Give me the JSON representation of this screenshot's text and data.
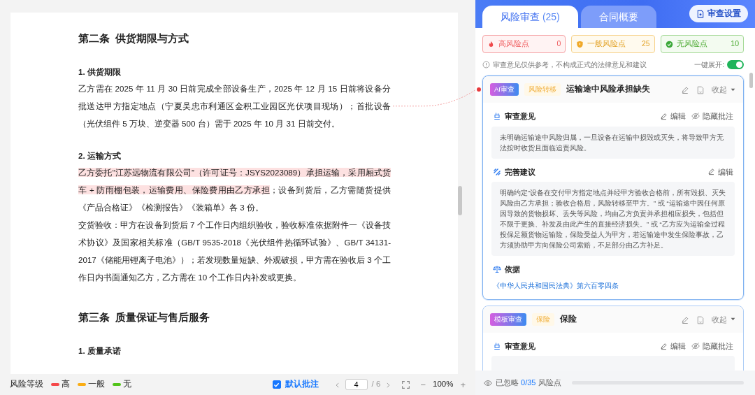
{
  "document": {
    "blocks": [
      {
        "kind": "heading",
        "text": "第二条  供货期限与方式"
      },
      {
        "kind": "subheading",
        "text": "**1.** 供货期限"
      },
      {
        "kind": "paragraph",
        "parts": [
          {
            "text": "乙方需在 2025 年 11 月 30 日前完成全部设备生产，2025 年 12 月 15 日前将设备分批送达甲方指定地点（宁夏吴忠市利通区金积工业园区光伏项目现场）；首批设备（光伏组件 5 万块、逆变器 500 台）需于 2025 年 10 月 31 日前交付。",
            "highlight": false
          }
        ]
      },
      {
        "kind": "subheading",
        "text": "**2.** 运输方式"
      },
      {
        "kind": "paragraph",
        "parts": [
          {
            "text": "乙方委托“江苏远物流有限公司”（许可证号：JSYS2023089）承担运输，采用厢式货车 + 防雨棚包装，运输费用、保险费用由乙方承担",
            "highlight": true
          },
          {
            "text": "；设备到货后，乙方需随货提供《产品合格证》《检测报告》《装箱单》各 3 份。",
            "highlight": false
          }
        ]
      },
      {
        "kind": "paragraph",
        "parts": [
          {
            "text": "交货验收：甲方在设备到货后 7 个工作日内组织验收，验收标准依据附件一《设备技术协议》及国家相关标准（GB/T 9535-2018《光伏组件热循环试验》、GB/T 34131-2017《储能用锂离子电池》）；若发现数量短缺、外观破损，甲方需在验收后 3 个工作日内书面通知乙方，乙方需在 10 个工作日内补发或更换。",
            "highlight": false
          }
        ]
      },
      {
        "kind": "heading",
        "text": "第三条  质量保证与售后服务"
      },
      {
        "kind": "subheading",
        "text": "**1.** 质量承诺"
      }
    ]
  },
  "bottom_bar": {
    "legend_title": "风险等级",
    "legend": [
      {
        "label": "高",
        "color": "#f5484a"
      },
      {
        "label": "一般",
        "color": "#faad14"
      },
      {
        "label": "无",
        "color": "#52c41a"
      }
    ],
    "default_annotation": {
      "label": "默认批注",
      "checked": true
    },
    "page": {
      "current": "4",
      "total": "/ 6"
    },
    "zoom": "100%",
    "zoom_out": "−",
    "zoom_in": "+"
  },
  "review_panel": {
    "tabs": [
      {
        "label": "风险审查",
        "count": "(25)",
        "selected": true
      },
      {
        "label": "合同概要",
        "selected": false
      }
    ],
    "settings_button": "审查设置",
    "stats": [
      {
        "kind": "high",
        "label": "高风险点",
        "count": "0"
      },
      {
        "kind": "medium",
        "label": "一般风险点",
        "count": "25"
      },
      {
        "kind": "none",
        "label": "无风险点",
        "count": "10"
      }
    ],
    "notice": "审查意见仅供参考，不构成正式的法律意见和建议",
    "expand_all": {
      "label": "一键展开:",
      "on": true
    },
    "cards": [
      {
        "source": "AI审查",
        "category": "风险转移",
        "title": "运输途中风险承担缺失",
        "collapse": "收起",
        "linked": true,
        "sections": [
          {
            "kind": "opinion",
            "title": "审查意见",
            "edit": "编辑",
            "hide": "隐藏批注",
            "body": "未明确运输途中风险归属，一旦设备在运输中损毁或灭失，将导致甲方无法按时收货且面临追责风险。"
          },
          {
            "kind": "suggestion",
            "title": "完善建议",
            "edit": "编辑",
            "body": "明确约定“设备在交付甲方指定地点并经甲方验收合格前，所有毁损、灭失风险由乙方承担；验收合格后，风险转移至甲方。” 或 “运输途中因任何原因导致的货物损坏、丢失等风险，均由乙方负责并承担相应损失，包括但不限于更换、补发及由此产生的直接经济损失。” 或 “乙方应为运输全过程投保足额货物运输险，保险受益人为甲方，若运输途中发生保险事故，乙方须协助甲方向保险公司索赔，不足部分由乙方补足。"
          },
          {
            "kind": "basis",
            "title": "依据",
            "link": "《中华人民共和国民法典》第六百零四条"
          }
        ]
      },
      {
        "source": "模板审查",
        "category": "保险",
        "title": "保险",
        "collapse": "收起",
        "linked": false,
        "sections": [
          {
            "kind": "opinion",
            "title": "审查意见",
            "edit": "编辑",
            "hide": "隐藏批注"
          }
        ]
      }
    ],
    "footer": {
      "prefix": "已忽略",
      "count": "0/35",
      "suffix": "风险点",
      "level": 0
    }
  }
}
